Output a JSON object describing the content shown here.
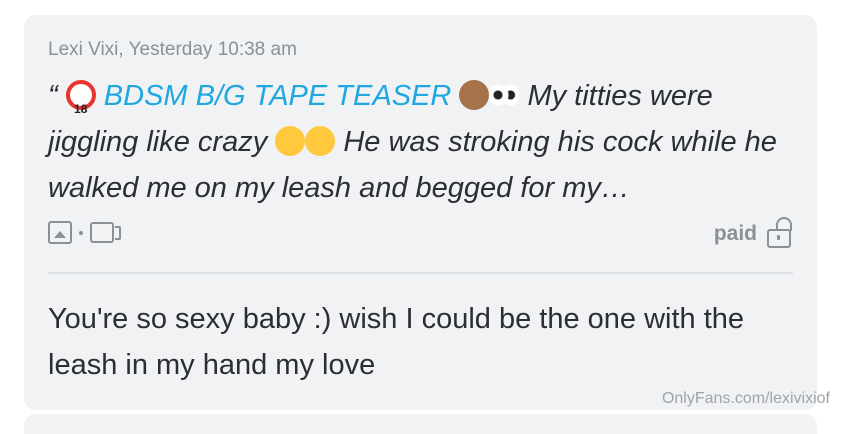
{
  "post": {
    "meta": "Lexi Vixi, Yesterday 10:38 am",
    "quote_open": "“",
    "teaser_title": "BDSM B/G TAPE TEASER",
    "text_1": "My titties were jiggling like crazy",
    "text_2": "He was stroking his cock while he walked me on my leash and begged for my…",
    "status": "paid",
    "emojis": [
      "no-under-18",
      "see-no-evil-monkey",
      "eyes",
      "squinting-tongue",
      "weary-face"
    ]
  },
  "reply": {
    "text": "You're so sexy baby :) wish I could be the one with the leash in my hand my love"
  },
  "watermark": "OnlyFans.com/lexivixiof",
  "colors": {
    "card_bg": "#f1f2f4",
    "accent": "#1ea7e1",
    "muted": "#8a9096",
    "text": "#2b2e33"
  }
}
